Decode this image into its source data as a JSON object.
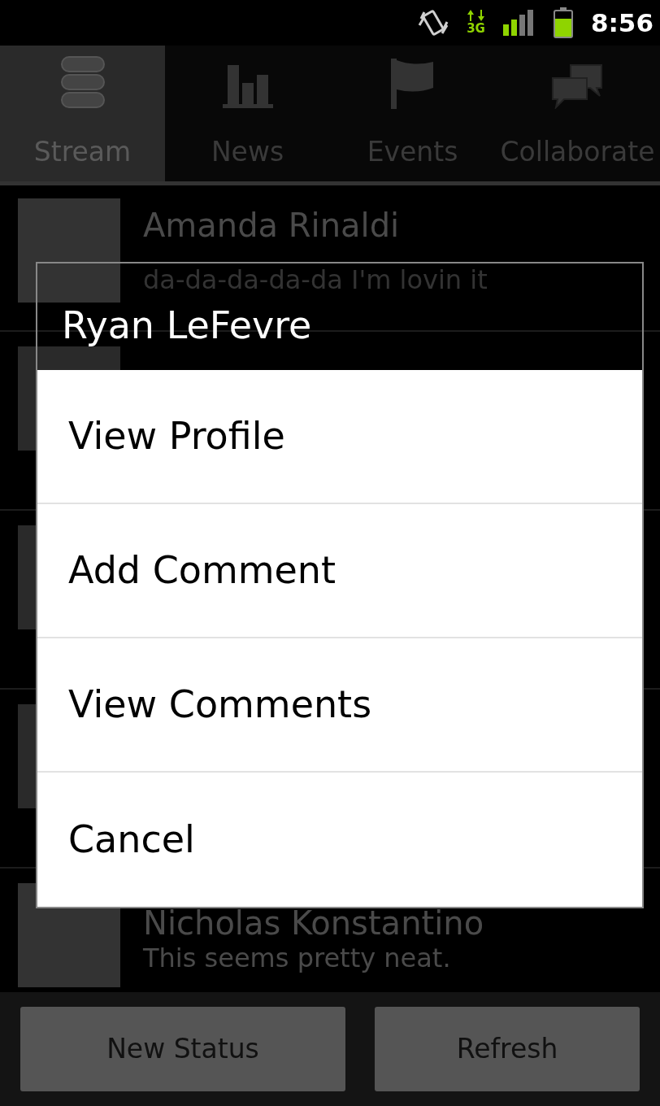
{
  "status_bar": {
    "network": "3G",
    "time": "8:56"
  },
  "tabs": [
    {
      "label": "Stream",
      "selected": true
    },
    {
      "label": "News",
      "selected": false
    },
    {
      "label": "Events",
      "selected": false
    },
    {
      "label": "Collaborate",
      "selected": false
    }
  ],
  "stream": [
    {
      "kind": "post",
      "name": "Amanda Rinaldi",
      "message": "da-da-da-da-da I'm lovin it"
    },
    {
      "kind": "covered"
    },
    {
      "kind": "covered"
    },
    {
      "kind": "covered"
    },
    {
      "kind": "post",
      "name": "Nicholas Konstantino",
      "message": "This seems pretty neat."
    }
  ],
  "dialog": {
    "title": "Ryan LeFevre",
    "items": [
      "View Profile",
      "Add Comment",
      "View Comments",
      "Cancel"
    ]
  },
  "buttons": [
    "New Status",
    "Refresh"
  ]
}
